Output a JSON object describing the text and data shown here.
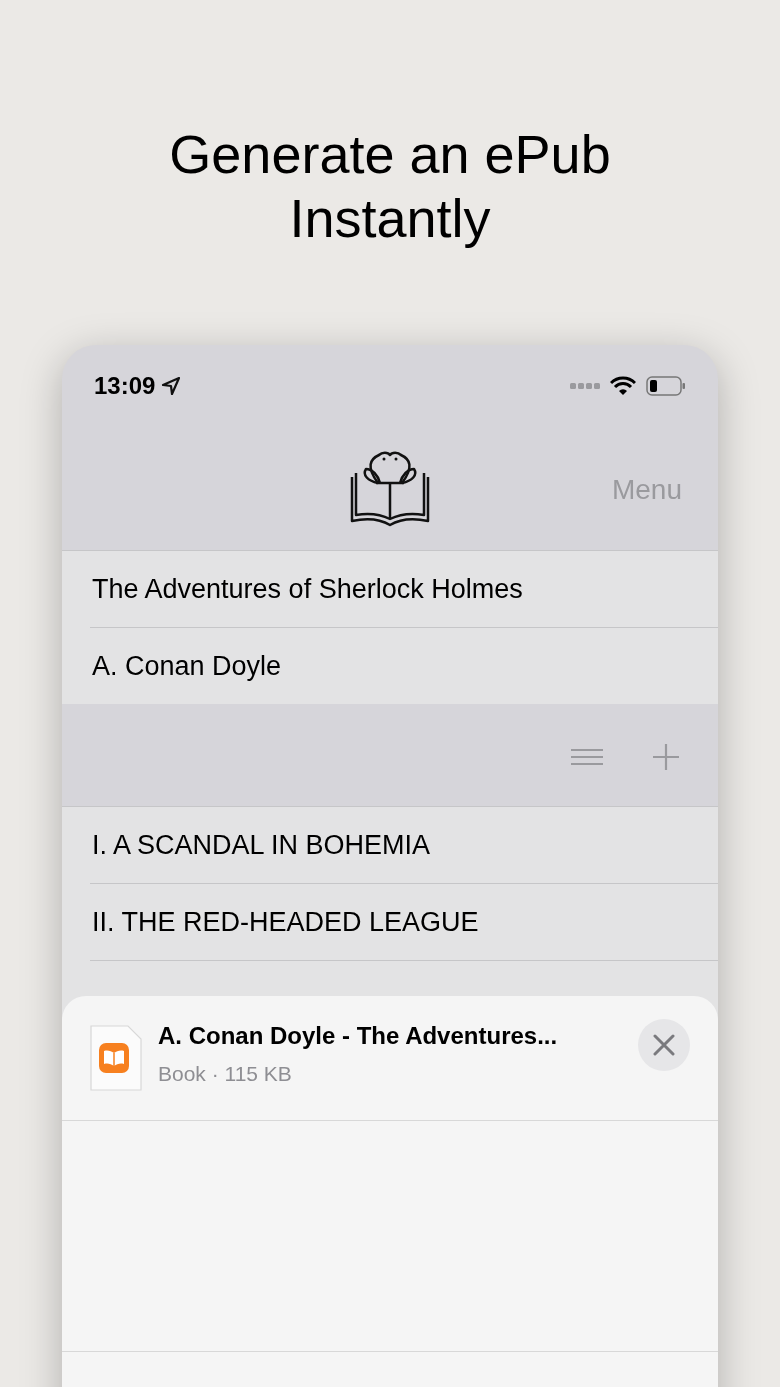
{
  "headline": [
    "Generate an ePub",
    "Instantly"
  ],
  "status_bar": {
    "time": "13:09"
  },
  "nav_bar": {
    "menu": "Menu"
  },
  "book": {
    "title": "The Adventures of Sherlock Holmes",
    "author": "A. Conan Doyle"
  },
  "chapters": [
    {
      "title": "I. A SCANDAL IN BOHEMIA"
    },
    {
      "title": "II. THE RED-HEADED LEAGUE"
    }
  ],
  "share_sheet": {
    "file_name": "A. Conan Doyle - The Adventures...",
    "file_info": "Book · 115 KB"
  }
}
